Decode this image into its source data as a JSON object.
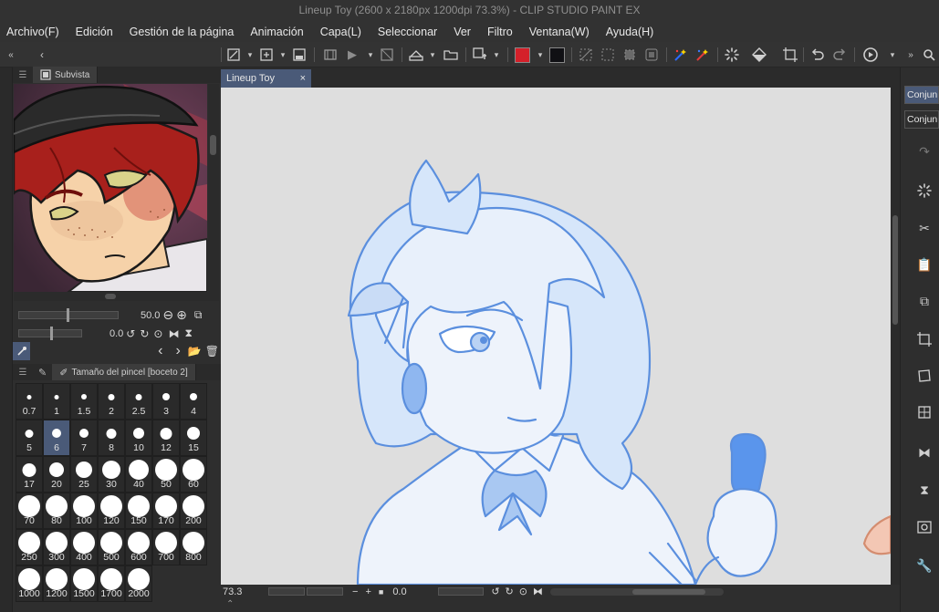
{
  "window": {
    "title": "Lineup Toy (2600 x 2180px 1200dpi 73.3%)  - CLIP STUDIO PAINT EX"
  },
  "menu": [
    "Archivo(F)",
    "Edición",
    "Gestión de la página",
    "Animación",
    "Capa(L)",
    "Seleccionar",
    "Ver",
    "Filtro",
    "Ventana(W)",
    "Ayuda(H)"
  ],
  "colors": {
    "main": "#d4202a",
    "sub": "#101014",
    "accent": "#4a5a78",
    "line": "#5b8fde"
  },
  "subview": {
    "tab_label": "Subvista",
    "zoom_value": "50.0",
    "rotate_value": "0.0"
  },
  "brush_panel": {
    "tab_label": "Tamaño del pincel [boceto 2]",
    "sizes": [
      "0.7",
      "1",
      "1.5",
      "2",
      "2.5",
      "3",
      "4",
      "5",
      "6",
      "7",
      "8",
      "10",
      "12",
      "15",
      "17",
      "20",
      "25",
      "30",
      "40",
      "50",
      "60",
      "70",
      "80",
      "100",
      "120",
      "150",
      "170",
      "200",
      "250",
      "300",
      "400",
      "500",
      "600",
      "700",
      "800",
      "1000",
      "1200",
      "1500",
      "1700",
      "2000"
    ],
    "selected": "6"
  },
  "document": {
    "tab_label": "Lineup Toy",
    "close_glyph": "×"
  },
  "status": {
    "zoom": "73.3",
    "angle": "0.0"
  },
  "right_panel": {
    "items": [
      "Conjun",
      "Conjun"
    ]
  }
}
